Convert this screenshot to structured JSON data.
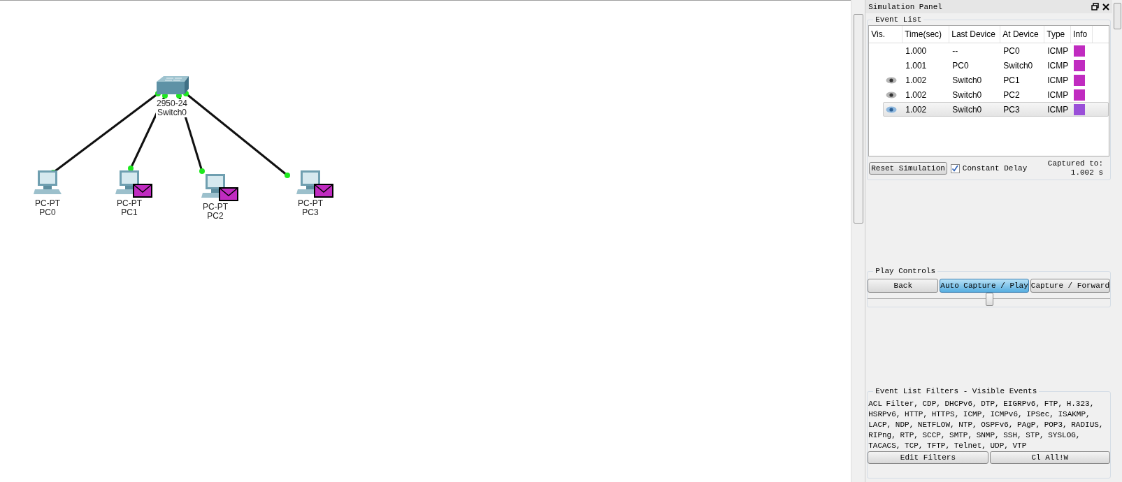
{
  "topology": {
    "switch": {
      "model": "2950-24",
      "name": "Switch0"
    },
    "pcs": [
      {
        "model": "PC-PT",
        "name": "PC0",
        "link_up": true,
        "envelope": false
      },
      {
        "model": "PC-PT",
        "name": "PC1",
        "link_up": true,
        "envelope": true
      },
      {
        "model": "PC-PT",
        "name": "PC2",
        "link_up": true,
        "envelope": true
      },
      {
        "model": "PC-PT",
        "name": "PC3",
        "link_up": true,
        "envelope": true
      }
    ]
  },
  "panel": {
    "title": "Simulation Panel",
    "event_list": {
      "title": "Event List",
      "columns": [
        "Vis.",
        "Time(sec)",
        "Last Device",
        "At Device",
        "Type",
        "Info"
      ],
      "rows": [
        {
          "visible": false,
          "time": "1.000",
          "last_device": "--",
          "at_device": "PC0",
          "type": "ICMP",
          "color": "#c02bc0",
          "selected": false
        },
        {
          "visible": false,
          "time": "1.001",
          "last_device": "PC0",
          "at_device": "Switch0",
          "type": "ICMP",
          "color": "#c02bc0",
          "selected": false
        },
        {
          "visible": true,
          "time": "1.002",
          "last_device": "Switch0",
          "at_device": "PC1",
          "type": "ICMP",
          "color": "#c02bc0",
          "selected": false
        },
        {
          "visible": true,
          "time": "1.002",
          "last_device": "Switch0",
          "at_device": "PC2",
          "type": "ICMP",
          "color": "#c02bc0",
          "selected": false
        },
        {
          "visible": true,
          "time": "1.002",
          "last_device": "Switch0",
          "at_device": "PC3",
          "type": "ICMP",
          "color": "#9a4fd8",
          "selected": true
        }
      ]
    },
    "reset_button": "Reset Simulation",
    "constant_delay": {
      "label": "Constant Delay",
      "checked": true
    },
    "captured": {
      "label": "Captured to:",
      "value": "1.002 s"
    },
    "play_controls": {
      "title": "Play Controls",
      "buttons": [
        {
          "label": "Back",
          "selected": false
        },
        {
          "label": "Auto Capture / Play",
          "selected": true
        },
        {
          "label": "Capture / Forward",
          "selected": false
        }
      ],
      "speed": {
        "level": 0.5
      }
    },
    "filters": {
      "title": "Event List Filters - Visible Events",
      "text": "ACL Filter, CDP, DHCPv6, DTP, EIGRPv6, FTP, H.323, HSRPv6, HTTP, HTTPS, ICMP, ICMPv6, IPSec, ISAKMP, LACP, NDP, NETFLOW, NTP, OSPFv6, PAgP, POP3, RADIUS, RIPng, RTP, SCCP, SMTP, SNMP, SSH, STP, SYSLOG, TACACS, TCP, TFTP, Telnet, UDP, VTP",
      "buttons": [
        "Edit Filters",
        "Cl All!W"
      ]
    }
  }
}
